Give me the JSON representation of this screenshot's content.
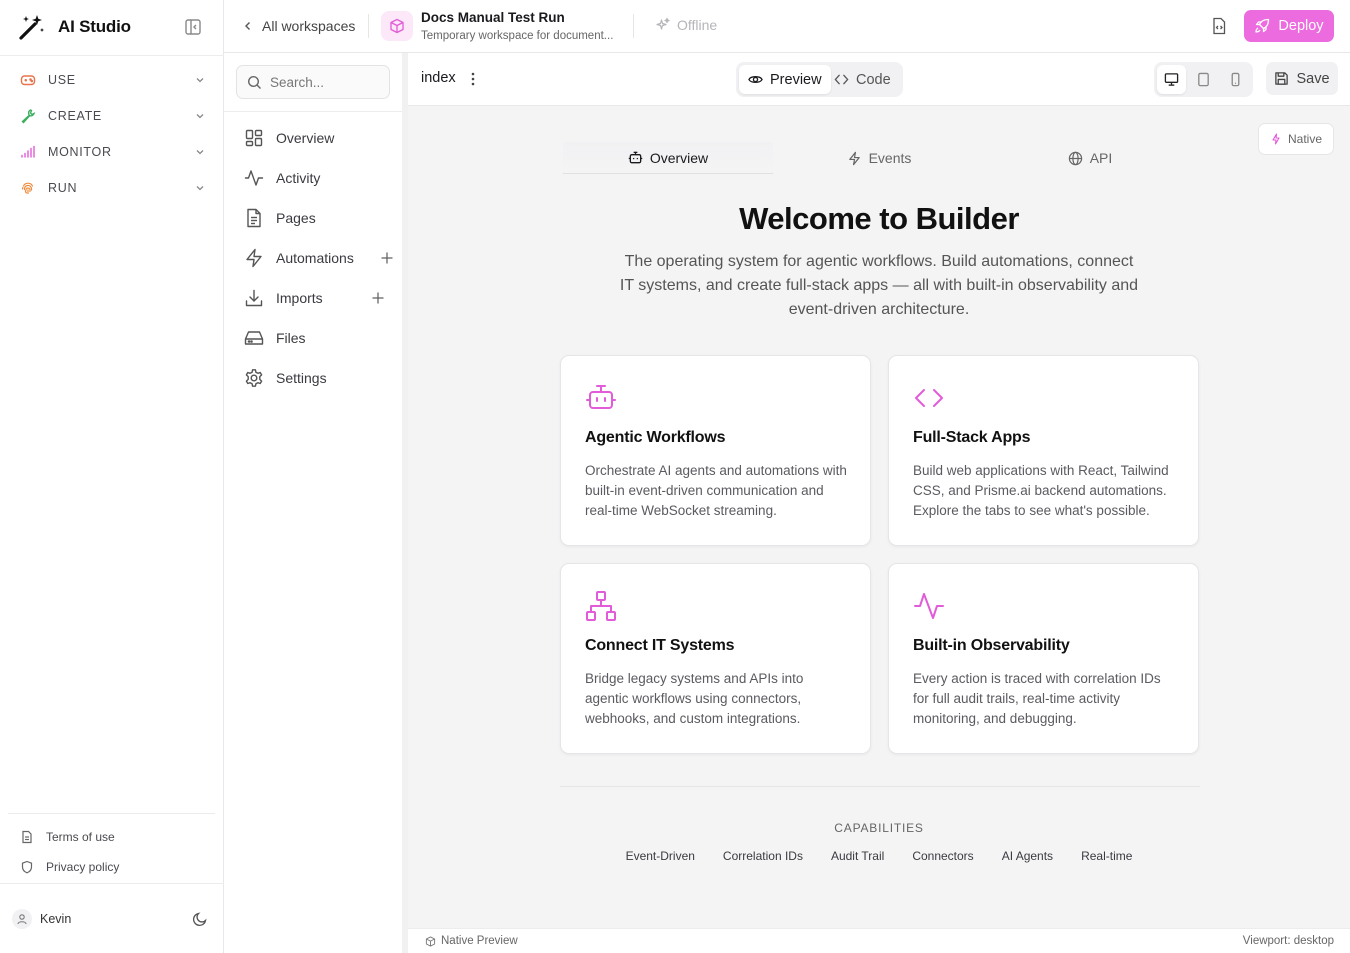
{
  "app": {
    "name": "AI Studio"
  },
  "sidebar": {
    "groups": [
      {
        "label": "USE",
        "icon": "gamepad-icon",
        "color": "#e8734a"
      },
      {
        "label": "CREATE",
        "icon": "wrench-icon",
        "color": "#3cae5e"
      },
      {
        "label": "MONITOR",
        "icon": "signal-bars-icon",
        "color": "#e25bd8"
      },
      {
        "label": "RUN",
        "icon": "fingerprint-icon",
        "color": "#ef8a3a"
      }
    ],
    "footer": {
      "terms": "Terms of use",
      "privacy": "Privacy policy"
    },
    "user": {
      "name": "Kevin"
    }
  },
  "header": {
    "back_label": "All workspaces",
    "workspace_title": "Docs Manual Test Run",
    "workspace_subtitle": "Temporary workspace for document...",
    "status": "Offline",
    "deploy_label": "Deploy",
    "accent_color": "#ec6bdf"
  },
  "workspace_nav": {
    "search_placeholder": "Search...",
    "items": [
      {
        "label": "Overview",
        "icon": "layout-grid-icon"
      },
      {
        "label": "Activity",
        "icon": "activity-icon"
      },
      {
        "label": "Pages",
        "icon": "file-text-icon"
      },
      {
        "label": "Automations",
        "icon": "zap-icon",
        "addable": true
      },
      {
        "label": "Imports",
        "icon": "download-icon",
        "addable": true
      },
      {
        "label": "Files",
        "icon": "hard-drive-icon"
      },
      {
        "label": "Settings",
        "icon": "gear-icon"
      }
    ]
  },
  "editor": {
    "file_name": "index",
    "modes": {
      "preview": "Preview",
      "code": "Code",
      "active": "preview"
    },
    "devices": {
      "active": "desktop"
    },
    "save_label": "Save"
  },
  "preview": {
    "native_badge": "Native",
    "tabs": [
      {
        "label": "Overview",
        "icon": "robot-icon",
        "active": true
      },
      {
        "label": "Events",
        "icon": "zap-icon",
        "active": false
      },
      {
        "label": "API",
        "icon": "globe-icon",
        "active": false
      }
    ],
    "title": "Welcome to Builder",
    "subtitle": "The operating system for agentic workflows. Build automations, connect IT systems, and create full-stack apps — all with built-in observability and event-driven architecture.",
    "cards": [
      {
        "title": "Agentic Workflows",
        "icon": "robot-icon",
        "description": "Orchestrate AI agents and automations with built-in event-driven communication and real-time WebSocket streaming."
      },
      {
        "title": "Full-Stack Apps",
        "icon": "code-icon",
        "description": "Build web applications with React, Tailwind CSS, and Prisme.ai backend automations. Explore the tabs to see what's possible."
      },
      {
        "title": "Connect IT Systems",
        "icon": "network-icon",
        "description": "Bridge legacy systems and APIs into agentic workflows using connectors, webhooks, and custom integrations."
      },
      {
        "title": "Built-in Observability",
        "icon": "activity-icon",
        "description": "Every action is traced with correlation IDs for full audit trails, real-time activity monitoring, and debugging."
      }
    ],
    "capabilities_heading": "CAPABILITIES",
    "capabilities": [
      "Event-Driven",
      "Correlation IDs",
      "Audit Trail",
      "Connectors",
      "AI Agents",
      "Real-time"
    ]
  },
  "status_bar": {
    "left": "Native Preview",
    "right": "Viewport: desktop"
  }
}
